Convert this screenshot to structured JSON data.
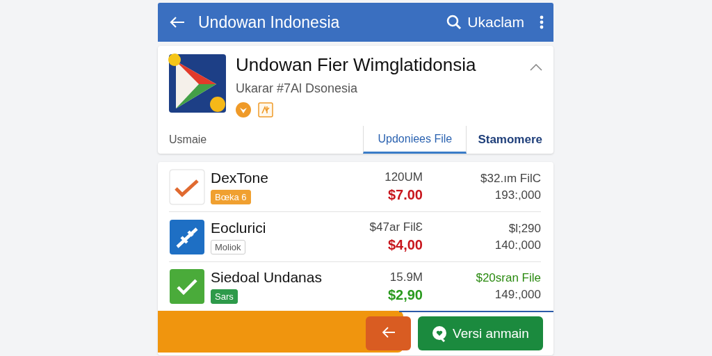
{
  "app_bar": {
    "title": "Undowan Indonesia",
    "search_label": "Ukaclam"
  },
  "app": {
    "name": "Undowan Fier Wimglatidonsia",
    "subtitle": "Ukarar #7Al Dsonesia",
    "expanded": true
  },
  "tabs": [
    {
      "label": "Usmaie",
      "selected": false,
      "bold": false
    },
    {
      "label": "Updoniees File",
      "selected": true,
      "bold": false
    },
    {
      "label": "Stamomere",
      "selected": false,
      "bold": true
    }
  ],
  "rows": [
    {
      "kind": "orange-check",
      "name": "DexTone",
      "badge": {
        "text": "Bœka 6",
        "color": "#f0a030"
      },
      "size": "120UM",
      "price": {
        "text": "$7.00",
        "color": "#c8161d"
      },
      "file": {
        "text": "$32.ım FilC",
        "color": "#444444"
      },
      "count": "193:,000"
    },
    {
      "kind": "blue-pen",
      "name": "Eoclurici",
      "badge": {
        "text": "Moliok",
        "color": "#ffffff"
      },
      "size": "$47ar FilƐ",
      "price": {
        "text": "$4,00",
        "color": "#c8161d"
      },
      "file": {
        "text": "$l;290",
        "color": "#444444"
      },
      "count": "140:,000"
    },
    {
      "kind": "green-check",
      "name": "Siedoal Undanas",
      "badge": {
        "text": "Sars",
        "color": "#2e9a4a"
      },
      "size": "15.9M",
      "price": {
        "text": "$2,90",
        "color": "#2a9a1e"
      },
      "file": {
        "text": "$20sran File",
        "color": "#2a8a10"
      },
      "count": "149:,000"
    }
  ],
  "bottom_bar": {
    "level": 0.62,
    "action_label": "Versi anmain"
  }
}
